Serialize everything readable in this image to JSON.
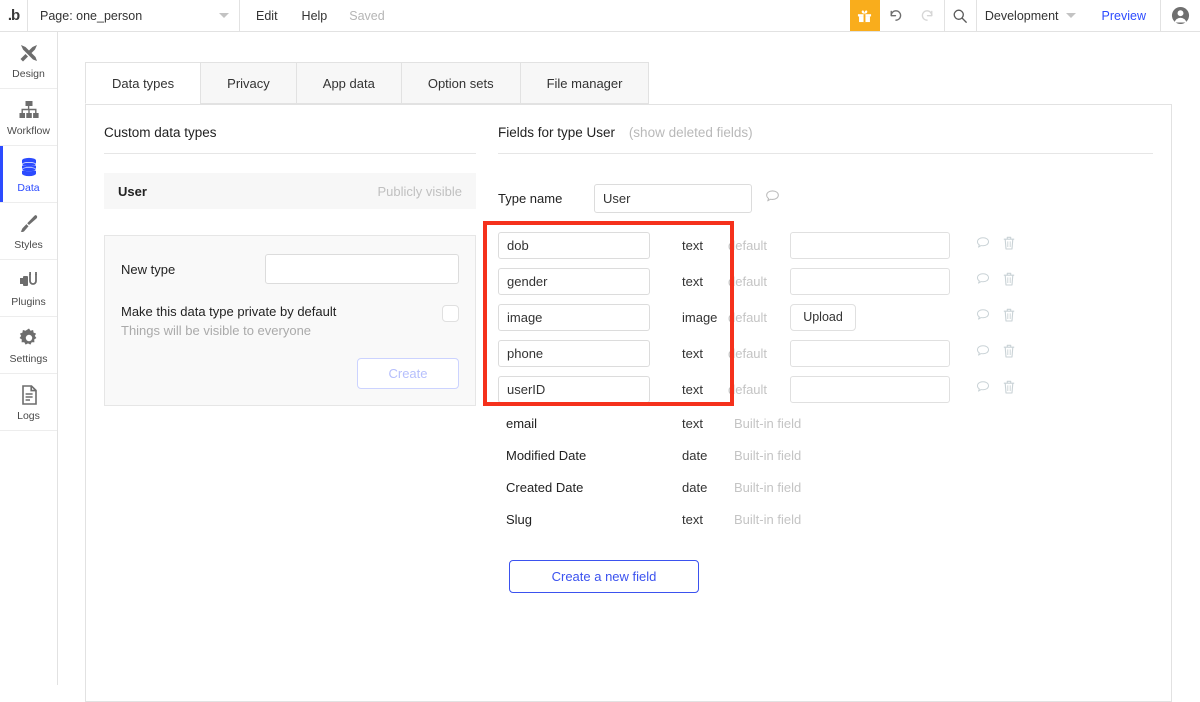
{
  "topbar": {
    "logo": "bubble-logo",
    "page_label": "Page: one_person",
    "edit_label": "Edit",
    "help_label": "Help",
    "saved_label": "Saved",
    "gift_icon": "gift-icon",
    "undo_icon": "undo-icon",
    "redo_icon": "redo-icon",
    "search_icon": "search-icon",
    "version_label": "Development",
    "preview_label": "Preview",
    "avatar_icon": "account-avatar-icon",
    "accent_orange": "#f9ad1c",
    "accent_blue": "#2c4bff"
  },
  "sidebar": {
    "items": [
      {
        "label": "Design",
        "icon": "design-tools-icon",
        "active": false
      },
      {
        "label": "Workflow",
        "icon": "workflow-icon",
        "active": false
      },
      {
        "label": "Data",
        "icon": "database-icon",
        "active": true
      },
      {
        "label": "Styles",
        "icon": "paintbrush-icon",
        "active": false
      },
      {
        "label": "Plugins",
        "icon": "plug-icon",
        "active": false
      },
      {
        "label": "Settings",
        "icon": "gear-icon",
        "active": false
      },
      {
        "label": "Logs",
        "icon": "document-icon",
        "active": false
      }
    ]
  },
  "tabs": [
    {
      "label": "Data types",
      "active": true
    },
    {
      "label": "Privacy",
      "active": false
    },
    {
      "label": "App data",
      "active": false
    },
    {
      "label": "Option sets",
      "active": false
    },
    {
      "label": "File manager",
      "active": false
    }
  ],
  "left_panel": {
    "heading": "Custom data types",
    "type_row": {
      "name": "User",
      "visibility": "Publicly visible"
    },
    "new_type": {
      "label": "New type",
      "value": "",
      "placeholder": "",
      "private_title": "Make this data type private by default",
      "private_sub": "Things will be visible to everyone",
      "checkbox_checked": false,
      "create_label": "Create",
      "create_disabled": true
    }
  },
  "right_panel": {
    "heading": "Fields for type User",
    "heading_link": "(show deleted fields)",
    "type_name_label": "Type name",
    "type_name_value": "User",
    "comment_icon": "comment-bubble-icon",
    "default_label": "default",
    "builtin_label": "Built-in field",
    "upload_label": "Upload",
    "delete_icon": "trash-icon",
    "custom_fields": [
      {
        "name": "dob",
        "type": "text",
        "default_kind": "input",
        "default_value": ""
      },
      {
        "name": "gender",
        "type": "text",
        "default_kind": "input",
        "default_value": ""
      },
      {
        "name": "image",
        "type": "image",
        "default_kind": "upload",
        "default_value": ""
      },
      {
        "name": "phone",
        "type": "text",
        "default_kind": "input",
        "default_value": ""
      },
      {
        "name": "userID",
        "type": "text",
        "default_kind": "input",
        "default_value": ""
      }
    ],
    "builtin_fields": [
      {
        "name": "email",
        "type": "text"
      },
      {
        "name": "Modified Date",
        "type": "date"
      },
      {
        "name": "Created Date",
        "type": "date"
      },
      {
        "name": "Slug",
        "type": "text"
      }
    ],
    "create_field_label": "Create a new field",
    "highlight_color": "#f5311c"
  }
}
